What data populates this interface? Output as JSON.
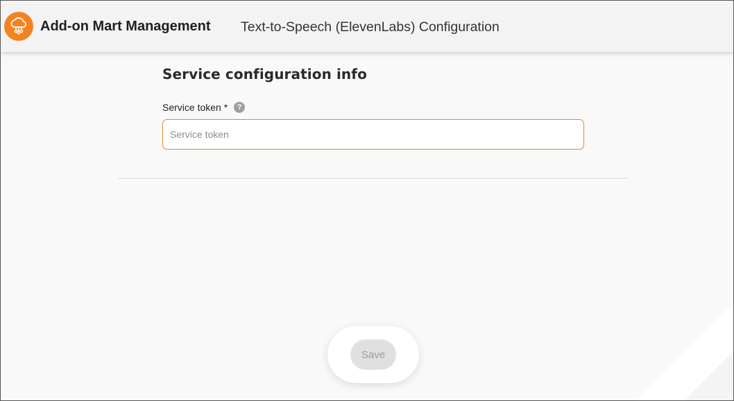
{
  "header": {
    "logo_icon": "cloud-rain-icon",
    "brand_color": "#f58220",
    "app_title": "Add-on Mart Management",
    "page_title": "Text-to-Speech (ElevenLabs) Configuration"
  },
  "form": {
    "section_heading": "Service configuration info",
    "service_token": {
      "label": "Service token *",
      "help_icon": "question-circle-icon",
      "help_glyph": "?",
      "placeholder": "Service token",
      "value": ""
    }
  },
  "footer": {
    "save_label": "Save",
    "save_enabled": false
  },
  "colors": {
    "accent": "#f58220",
    "input_border": "#e08a2e",
    "background": "#f9f9f9"
  }
}
